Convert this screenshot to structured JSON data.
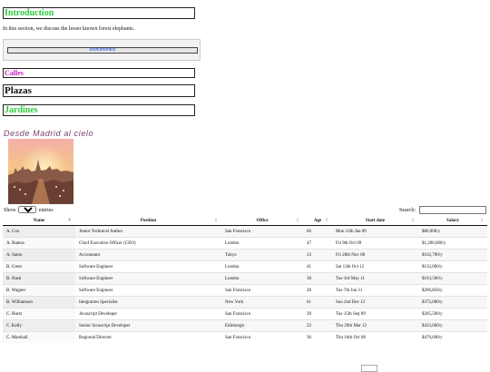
{
  "introduction": {
    "heading": "Introduction",
    "text": "In this section, we discuss the lesser known forest elephants."
  },
  "monumentos": {
    "label": "Monumentos"
  },
  "sections": {
    "calles": "Calles",
    "plazas": "Plazas",
    "jardines": "Jardines"
  },
  "gallery": {
    "title": "Desde Madrid al cielo"
  },
  "table_controls": {
    "show_label": "Show",
    "entries_label": "entries",
    "length_value": "10",
    "search_label": "Search:"
  },
  "table": {
    "columns": [
      "Name",
      "Position",
      "Office",
      "Age",
      "Start date",
      "Salary"
    ],
    "rows": [
      [
        "A. Cox",
        "Junior Technical Author",
        "San Francisco",
        "66",
        "Mon 12th Jan 09",
        "$86,000/y"
      ],
      [
        "A. Ramos",
        "Chief Executive Officer (CEO)",
        "London",
        "47",
        "Fri 9th Oct 09",
        "$1,200,000/y"
      ],
      [
        "A. Satou",
        "Accountant",
        "Tokyo",
        "33",
        "Fri 28th Nov 08",
        "$162,700/y"
      ],
      [
        "B. Greer",
        "Software Engineer",
        "London",
        "41",
        "Sat 13th Oct 12",
        "$132,000/y"
      ],
      [
        "B. Nash",
        "Software Engineer",
        "London",
        "38",
        "Tue 3rd May 11",
        "$163,500/y"
      ],
      [
        "B. Wagner",
        "Software Engineer",
        "San Francisco",
        "28",
        "Tue 7th Jun 11",
        "$206,850/y"
      ],
      [
        "B. Williamson",
        "Integration Specialist",
        "New York",
        "61",
        "Sun 2nd Dec 12",
        "$372,000/y"
      ],
      [
        "C. Hurst",
        "Javascript Developer",
        "San Francisco",
        "39",
        "Tue 15th Sep 09",
        "$205,500/y"
      ],
      [
        "C. Kelly",
        "Senior Javascript Developer",
        "Edinburgh",
        "22",
        "Thu 29th Mar 12",
        "$433,060/y"
      ],
      [
        "C. Marshall",
        "Regional Director",
        "San Francisco",
        "36",
        "Thu 16th Oct 08",
        "$470,600/y"
      ]
    ]
  },
  "colors": {
    "green": "#2ecc40",
    "magenta": "#c020c0",
    "link_blue": "#1a4fd8",
    "title_purple": "#7b3b6e"
  }
}
